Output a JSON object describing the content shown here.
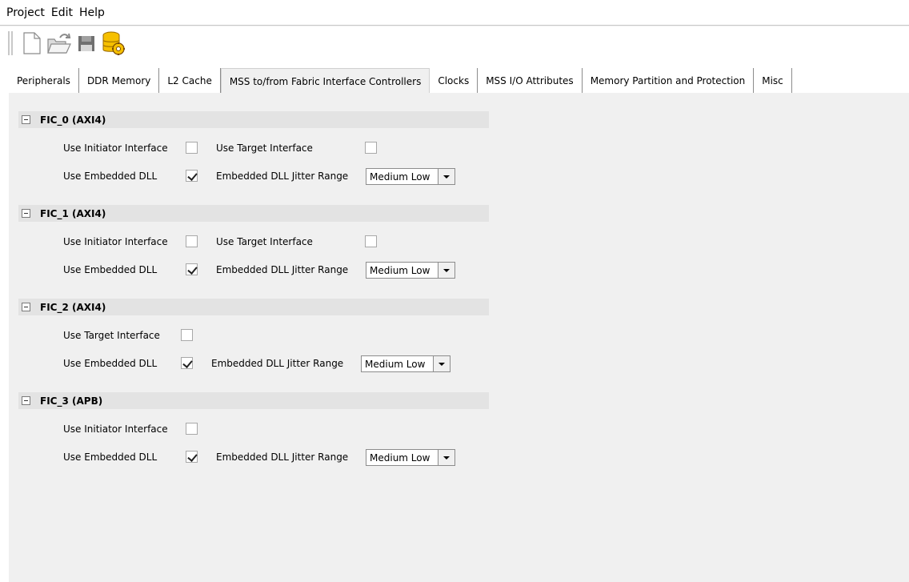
{
  "menu": {
    "items": [
      "Project",
      "Edit",
      "Help"
    ]
  },
  "toolbar": {
    "buttons": [
      "new-file-icon",
      "open-folder-icon",
      "save-icon",
      "database-settings-icon"
    ]
  },
  "tabs": [
    {
      "label": "Peripherals",
      "active": false
    },
    {
      "label": "DDR Memory",
      "active": false
    },
    {
      "label": "L2 Cache",
      "active": false
    },
    {
      "label": "MSS to/from Fabric Interface Controllers",
      "active": true
    },
    {
      "label": "Clocks",
      "active": false
    },
    {
      "label": "MSS I/O Attributes",
      "active": false
    },
    {
      "label": "Memory Partition and Protection",
      "active": false
    },
    {
      "label": "Misc",
      "active": false
    }
  ],
  "groups": [
    {
      "title": "FIC_0 (AXI4)",
      "initiator_label": "Use Initiator Interface",
      "initiator_checked": false,
      "target_label": "Use Target Interface",
      "target_checked": false,
      "dll_label": "Use Embedded DLL",
      "dll_checked": true,
      "jitter_label": "Embedded DLL Jitter Range",
      "jitter_value": "Medium Low"
    },
    {
      "title": "FIC_1 (AXI4)",
      "initiator_label": "Use Initiator Interface",
      "initiator_checked": false,
      "target_label": "Use Target Interface",
      "target_checked": false,
      "dll_label": "Use Embedded DLL",
      "dll_checked": true,
      "jitter_label": "Embedded DLL Jitter Range",
      "jitter_value": "Medium Low"
    },
    {
      "title": "FIC_2 (AXI4)",
      "target_label": "Use Target Interface",
      "target_checked": false,
      "dll_label": "Use Embedded DLL",
      "dll_checked": true,
      "jitter_label": "Embedded DLL Jitter Range",
      "jitter_value": "Medium Low"
    },
    {
      "title": "FIC_3 (APB)",
      "initiator_label": "Use Initiator Interface",
      "initiator_checked": false,
      "dll_label": "Use Embedded DLL",
      "dll_checked": true,
      "jitter_label": "Embedded DLL Jitter Range",
      "jitter_value": "Medium Low"
    }
  ]
}
